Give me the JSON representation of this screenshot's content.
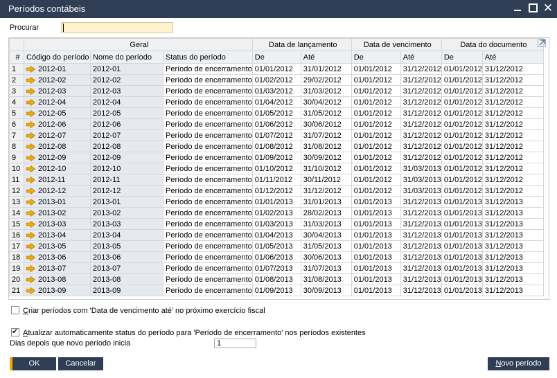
{
  "window": {
    "title": "Períodos contábeis"
  },
  "search": {
    "label": "Procurar",
    "value": ""
  },
  "columns": {
    "groups": [
      "Geral",
      "Data de lançamento",
      "Data de vencimento",
      "Data do documento"
    ],
    "headers": [
      "#",
      "Código do período",
      "Nome do período",
      "Status do período",
      "De",
      "Até",
      "De",
      "Até",
      "De",
      "Até"
    ]
  },
  "rows": [
    [
      "1",
      "2012-01",
      "2012-01",
      "Período de encerramento",
      "01/01/2012",
      "31/01/2012",
      "01/01/2012",
      "31/12/2012",
      "01/01/2012",
      "31/12/2012"
    ],
    [
      "2",
      "2012-02",
      "2012-02",
      "Período de encerramento",
      "01/02/2012",
      "29/02/2012",
      "01/01/2012",
      "31/12/2012",
      "01/01/2012",
      "31/12/2012"
    ],
    [
      "3",
      "2012-03",
      "2012-03",
      "Período de encerramento",
      "01/03/2012",
      "31/03/2012",
      "01/01/2012",
      "31/12/2012",
      "01/01/2012",
      "31/12/2012"
    ],
    [
      "4",
      "2012-04",
      "2012-04",
      "Período de encerramento",
      "01/04/2012",
      "30/04/2012",
      "01/01/2012",
      "31/12/2012",
      "01/01/2012",
      "31/12/2012"
    ],
    [
      "5",
      "2012-05",
      "2012-05",
      "Período de encerramento",
      "01/05/2012",
      "31/05/2012",
      "01/01/2012",
      "31/12/2012",
      "01/01/2012",
      "31/12/2012"
    ],
    [
      "6",
      "2012-06",
      "2012-06",
      "Período de encerramento",
      "01/06/2012",
      "30/06/2012",
      "01/01/2012",
      "31/12/2012",
      "01/01/2012",
      "31/12/2012"
    ],
    [
      "7",
      "2012-07",
      "2012-07",
      "Período de encerramento",
      "01/07/2012",
      "31/07/2012",
      "01/01/2012",
      "31/12/2012",
      "01/01/2012",
      "31/12/2012"
    ],
    [
      "8",
      "2012-08",
      "2012-08",
      "Período de encerramento",
      "01/08/2012",
      "31/08/2012",
      "01/01/2012",
      "31/12/2012",
      "01/01/2012",
      "31/12/2012"
    ],
    [
      "9",
      "2012-09",
      "2012-09",
      "Período de encerramento",
      "01/09/2012",
      "30/09/2012",
      "01/01/2012",
      "31/12/2012",
      "01/01/2012",
      "31/12/2012"
    ],
    [
      "10",
      "2012-10",
      "2012-10",
      "Período de encerramento",
      "01/10/2012",
      "31/10/2012",
      "01/01/2012",
      "31/03/2013",
      "01/01/2012",
      "31/12/2012"
    ],
    [
      "11",
      "2012-11",
      "2012-11",
      "Período de encerramento",
      "01/11/2012",
      "30/11/2012",
      "01/01/2012",
      "31/03/2013",
      "01/01/2012",
      "31/12/2012"
    ],
    [
      "12",
      "2012-12",
      "2012-12",
      "Período de encerramento",
      "01/12/2012",
      "31/12/2012",
      "01/01/2012",
      "31/03/2013",
      "01/01/2012",
      "31/12/2012"
    ],
    [
      "13",
      "2013-01",
      "2013-01",
      "Período de encerramento",
      "01/01/2013",
      "31/01/2013",
      "01/01/2013",
      "31/12/2013",
      "01/01/2013",
      "31/12/2013"
    ],
    [
      "14",
      "2013-02",
      "2013-02",
      "Período de encerramento",
      "01/02/2013",
      "28/02/2013",
      "01/01/2013",
      "31/12/2013",
      "01/01/2013",
      "31/12/2013"
    ],
    [
      "15",
      "2013-03",
      "2013-03",
      "Período de encerramento",
      "01/03/2013",
      "31/03/2013",
      "01/01/2013",
      "31/12/2013",
      "01/01/2013",
      "31/12/2013"
    ],
    [
      "16",
      "2013-04",
      "2013-04",
      "Período de encerramento",
      "01/04/2013",
      "30/04/2013",
      "01/01/2013",
      "31/12/2013",
      "01/01/2013",
      "31/12/2013"
    ],
    [
      "17",
      "2013-05",
      "2013-05",
      "Período de encerramento",
      "01/05/2013",
      "31/05/2013",
      "01/01/2013",
      "31/12/2013",
      "01/01/2013",
      "31/12/2013"
    ],
    [
      "18",
      "2013-06",
      "2013-06",
      "Período de encerramento",
      "01/06/2013",
      "30/06/2013",
      "01/01/2013",
      "31/12/2013",
      "01/01/2013",
      "31/12/2013"
    ],
    [
      "19",
      "2013-07",
      "2013-07",
      "Período de encerramento",
      "01/07/2013",
      "31/07/2013",
      "01/01/2013",
      "31/12/2013",
      "01/01/2013",
      "31/12/2013"
    ],
    [
      "20",
      "2013-08",
      "2013-08",
      "Período de encerramento",
      "01/08/2013",
      "31/08/2013",
      "01/01/2013",
      "31/12/2013",
      "01/01/2013",
      "31/12/2013"
    ],
    [
      "21",
      "2013-09",
      "2013-09",
      "Período de encerramento",
      "01/09/2013",
      "30/09/2013",
      "01/01/2013",
      "31/12/2013",
      "01/01/2013",
      "31/12/2013"
    ]
  ],
  "options": {
    "create_label_hotkey": "C",
    "create_label_rest": "riar períodos com 'Data de vencimento até' no próximo exercício fiscal",
    "create_checked": false,
    "update_label_hotkey": "A",
    "update_label_rest": "tualizar automaticamente status do período para 'Período de encerramento' nos períodos existentes",
    "update_checked": true,
    "days_label": "Dias depois que novo período inicia",
    "days_value": "1"
  },
  "buttons": {
    "ok": "OK",
    "cancel": "Cancelar",
    "novo_hotkey": "N",
    "novo_rest": "ovo período"
  },
  "colors": {
    "titlebar": "#2f3d55",
    "accent": "#f0ab00",
    "arrow": "#f0ab00"
  },
  "icons": {
    "row_link": "orange-arrow-icon",
    "expand": "expand-icon"
  }
}
